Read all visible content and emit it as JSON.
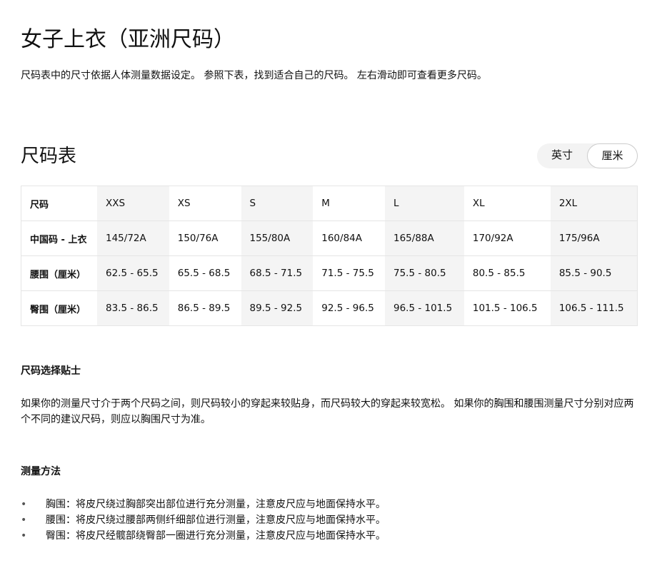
{
  "title": "女子上衣（亚洲尺码）",
  "intro": "尺码表中的尺寸依据人体测量数据设定。 参照下表，找到适合自己的尺码。 左右滑动即可查看更多尺码。",
  "chart_title": "尺码表",
  "unit_toggle": {
    "inch": "英寸",
    "cm": "厘米",
    "selected": "厘米"
  },
  "table": {
    "rows": [
      {
        "label": "尺码",
        "cells": [
          "XXS",
          "XS",
          "S",
          "M",
          "L",
          "XL",
          "2XL"
        ]
      },
      {
        "label": "中国码 - 上衣",
        "cells": [
          "145/72A",
          "150/76A",
          "155/80A",
          "160/84A",
          "165/88A",
          "170/92A",
          "175/96A"
        ]
      },
      {
        "label": "腰围（厘米）",
        "cells": [
          "62.5 - 65.5",
          "65.5 - 68.5",
          "68.5 - 71.5",
          "71.5 - 75.5",
          "75.5 - 80.5",
          "80.5 - 85.5",
          "85.5 - 90.5"
        ]
      },
      {
        "label": "臀围（厘米）",
        "cells": [
          "83.5 - 86.5",
          "86.5 - 89.5",
          "89.5 - 92.5",
          "92.5 - 96.5",
          "96.5 - 101.5",
          "101.5 - 106.5",
          "106.5 - 111.5"
        ]
      }
    ]
  },
  "tips_title": "尺码选择贴士",
  "tips": "如果你的测量尺寸介于两个尺码之间，则尺码较小的穿起来较贴身，而尺码较大的穿起来较宽松。 如果你的胸围和腰围测量尺寸分别对应两个不同的建议尺码，则应以胸围尺寸为准。",
  "measure_title": "测量方法",
  "measure": [
    "胸围：将皮尺绕过胸部突出部位进行充分测量，注意皮尺应与地面保持水平。",
    "腰围：将皮尺绕过腰部两侧纤细部位进行测量，注意皮尺应与地面保持水平。",
    "臀围：将皮尺经髋部绕臀部一圈进行充分测量，注意皮尺应与地面保持水平。"
  ]
}
